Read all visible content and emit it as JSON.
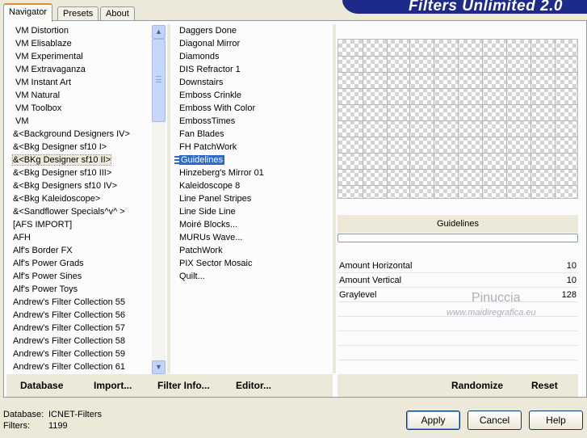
{
  "header": {
    "tabs": [
      "Navigator",
      "Presets",
      "About"
    ],
    "banner": "Filters Unlimited 2.0"
  },
  "categories": [
    "VM Distortion",
    "VM Elisablaze",
    "VM Experimental",
    "VM Extravaganza",
    "VM Instant Art",
    "VM Natural",
    "VM Toolbox",
    "VM",
    "&<Background Designers IV>",
    "&<Bkg Designer sf10 I>",
    "&<BKg Designer sf10 II>",
    "&<Bkg Designer sf10 III>",
    "&<Bkg Designers sf10 IV>",
    "&<Bkg Kaleidoscope>",
    "&<Sandflower Specials^v^ >",
    "[AFS IMPORT]",
    "AFH",
    "Alf's Border FX",
    "Alf's Power Grads",
    "Alf's Power Sines",
    "Alf's Power Toys",
    "Andrew's Filter Collection 55",
    "Andrew's Filter Collection 56",
    "Andrew's Filter Collection 57",
    "Andrew's Filter Collection 58",
    "Andrew's Filter Collection 59",
    "Andrew's Filter Collection 61"
  ],
  "selected_category": "&<BKg Designer sf10 II>",
  "filters": [
    "Daggers Done",
    "Diagonal Mirror",
    "Diamonds",
    "DIS Refractor 1",
    "Downstairs",
    "Emboss Crinkle",
    "Emboss With Color",
    "EmbossTimes",
    "Fan Blades",
    "FH PatchWork",
    "Guidelines",
    "Hinzeberg's Mirror 01",
    "Kaleidoscope 8",
    "Line Panel Stripes",
    "Line Side Line",
    "Moiré Blocks...",
    "MURUs Wave...",
    "PatchWork",
    "PIX Sector Mosaic",
    "Quilt..."
  ],
  "selected_filter": "Guidelines",
  "filter_name": "Guidelines",
  "params": [
    {
      "label": "Amount Horizontal",
      "value": "10"
    },
    {
      "label": "Amount Vertical",
      "value": "10"
    },
    {
      "label": "Graylevel",
      "value": "128"
    }
  ],
  "watermark": {
    "line1": "Pinuccia",
    "line2": "www.maidiregrafica.eu"
  },
  "toolbar": {
    "database": "Database",
    "import": "Import...",
    "filter_info": "Filter Info...",
    "editor": "Editor...",
    "randomize": "Randomize",
    "reset": "Reset"
  },
  "status": {
    "database_label": "Database:",
    "database_value": "ICNET-Filters",
    "filters_label": "Filters:",
    "filters_value": "1199"
  },
  "buttons": {
    "apply": "Apply",
    "cancel": "Cancel",
    "help": "Help"
  }
}
